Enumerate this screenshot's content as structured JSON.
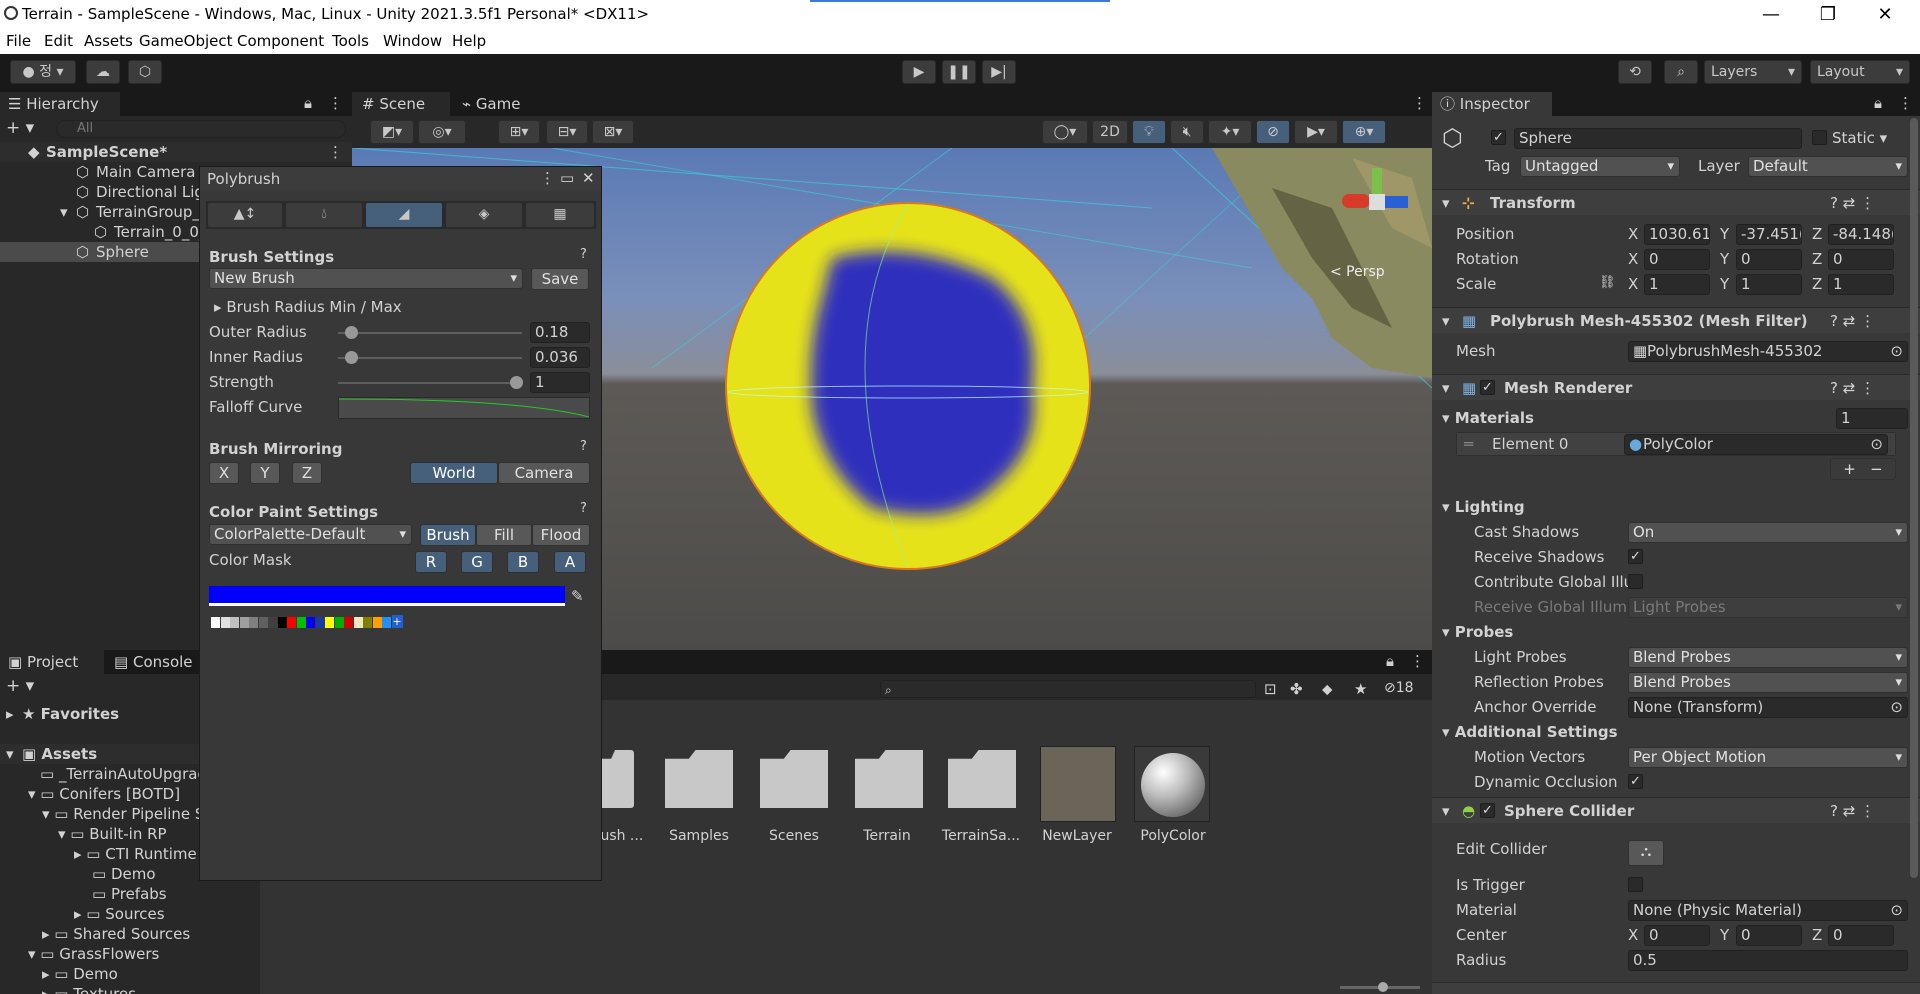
{
  "title": "Terrain - SampleScene - Windows, Mac, Linux - Unity 2021.3.5f1 Personal* <DX11>",
  "menu": [
    "File",
    "Edit",
    "Assets",
    "GameObject",
    "Component",
    "Tools",
    "Window",
    "Help"
  ],
  "toolbar": {
    "account": "정",
    "layers": "Layers",
    "layout": "Layout"
  },
  "hierarchy": {
    "tab": "Hierarchy",
    "search_placeholder": "All",
    "items": [
      "SampleScene*",
      "Main Camera",
      "Directional Lig",
      "TerrainGroup_(",
      "Terrain_0_0_",
      "Sphere"
    ]
  },
  "scene": {
    "tab_scene": "Scene",
    "tab_game": "Game",
    "mode2d": "2D",
    "persp": "< Persp"
  },
  "project": {
    "tab_project": "Project",
    "tab_console": "Console",
    "favorites": "Favorites",
    "assets": "Assets",
    "tree": [
      "_TerrainAutoUpgrad",
      "Conifers [BOTD]",
      "Render Pipeline S",
      "Built-in RP",
      "CTI Runtime",
      "Demo",
      "Prefabs",
      "Sources",
      "Shared Sources",
      "GrassFlowers",
      "Demo",
      "Textures"
    ],
    "count": "18",
    "grid": [
      "rush ...",
      "Samples",
      "Scenes",
      "Terrain",
      "TerrainSa...",
      "NewLayer",
      "PolyColor"
    ]
  },
  "polybrush": {
    "title": "Polybrush",
    "brush_settings": "Brush Settings",
    "preset": "New Brush",
    "save": "Save",
    "radius_minmax": "Brush Radius Min / Max",
    "outer_label": "Outer Radius",
    "outer_value": "0.18",
    "outer": 0.18,
    "inner_label": "Inner Radius",
    "inner_value": "0.036",
    "inner": 0.036,
    "strength_label": "Strength",
    "strength_value": "1",
    "strength": 1,
    "falloff": "Falloff Curve",
    "mirroring": "Brush Mirroring",
    "x": "X",
    "y": "Y",
    "z": "Z",
    "world": "World",
    "camera": "Camera",
    "color_paint": "Color Paint Settings",
    "palette": "ColorPalette-Default",
    "brush": "Brush",
    "fill": "Fill",
    "flood": "Flood",
    "color_mask": "Color Mask",
    "r": "R",
    "g": "G",
    "b": "B",
    "a": "A",
    "selected_color": "#0000ff",
    "swatches": [
      "#ffffff",
      "#e0e0e0",
      "#c0c0c0",
      "#a0a0a0",
      "#808080",
      "#606060",
      "#404040",
      "#000000",
      "#ff0000",
      "#00c000",
      "#0000ff",
      "#1a3aa0",
      "#ffff00",
      "#00b000",
      "#d00000",
      "#f0e8c0",
      "#808000",
      "#ffa000",
      "#2090ff"
    ]
  },
  "inspector": {
    "tab": "Inspector",
    "name": "Sphere",
    "static": "Static",
    "tag_label": "Tag",
    "tag": "Untagged",
    "layer_label": "Layer",
    "layer": "Default",
    "transform": "Transform",
    "position": "Position",
    "rotation": "Rotation",
    "scale": "Scale",
    "pos": [
      "1030.61",
      "-37.451(",
      "-84.148("
    ],
    "rot": [
      "0",
      "0",
      "0"
    ],
    "scl": [
      "1",
      "1",
      "1"
    ],
    "x": "X",
    "y": "Y",
    "z": "Z",
    "meshfilter": "Polybrush Mesh-455302 (Mesh Filter)",
    "mesh_label": "Mesh",
    "mesh": "PolybrushMesh-455302",
    "renderer": "Mesh Renderer",
    "materials": "Materials",
    "mat_count": "1",
    "element0": "Element 0",
    "mat": "PolyColor",
    "lighting": "Lighting",
    "cast_shadows": "Cast Shadows",
    "cast_val": "On",
    "receive_shadows": "Receive Shadows",
    "contrib_gi": "Contribute Global Illu",
    "receive_gi": "Receive Global Illumi",
    "receive_gi_val": "Light Probes",
    "probes": "Probes",
    "light_probes": "Light Probes",
    "light_probes_val": "Blend Probes",
    "refl_probes": "Reflection Probes",
    "refl_val": "Blend Probes",
    "anchor": "Anchor Override",
    "anchor_val": "None (Transform)",
    "additional": "Additional Settings",
    "motion": "Motion Vectors",
    "motion_val": "Per Object Motion",
    "dyn_occ": "Dynamic Occlusion",
    "collider": "Sphere Collider",
    "edit_collider": "Edit Collider",
    "is_trigger": "Is Trigger",
    "material": "Material",
    "material_val": "None (Physic Material)",
    "center": "Center",
    "center_v": [
      "0",
      "0",
      "0"
    ],
    "radius": "Radius",
    "radius_val": "0.5"
  },
  "colors": {
    "selected_blue": "#46607c",
    "sphere_yellow": "#e6e21a",
    "paint_blue": "#1a1ad0"
  }
}
